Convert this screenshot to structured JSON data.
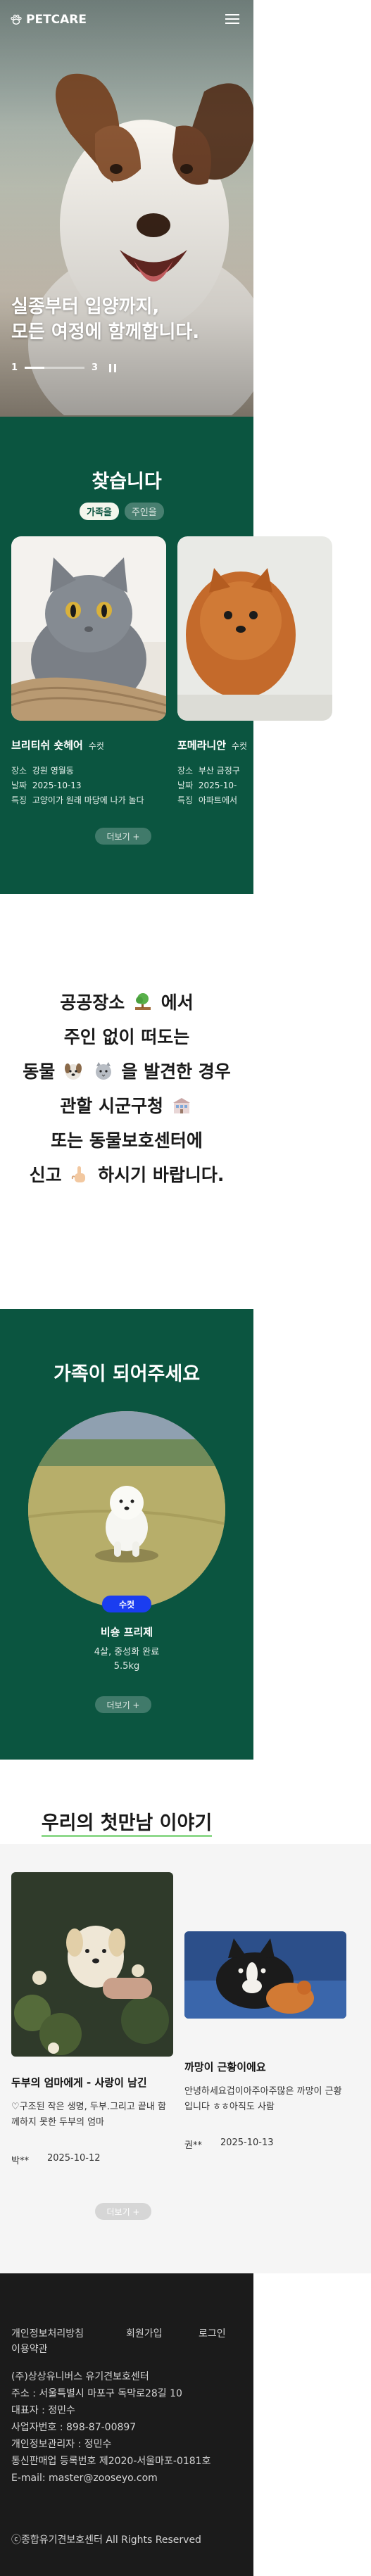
{
  "header": {
    "logo_text": "PETCARE",
    "logo_icon": "paw-icon",
    "menu_icon": "hamburger-icon"
  },
  "hero": {
    "headline_line1": "실종부터 입양까지,",
    "headline_line2": "모든 여정에 함께합니다.",
    "pager": {
      "current": "1",
      "total": "3",
      "progress": 0.33
    }
  },
  "find": {
    "title": "찾습니다",
    "tabs": [
      "가족을",
      "주인을"
    ],
    "active_tab": 0,
    "cards": [
      {
        "name": "브리티쉬 숏헤어",
        "sex": "수컷",
        "place_label": "장소",
        "place": "강원 영월동",
        "date_label": "날짜",
        "date": "2025-10-13",
        "feature_label": "특징",
        "feature": "고양이가 원래 마당에 나가 놀다"
      },
      {
        "name": "포메라니안",
        "sex": "수컷",
        "place_label": "장소",
        "place": "부산 금정구",
        "date_label": "날짜",
        "date": "2025-10-",
        "feature_label": "특징",
        "feature": "아파트에서"
      }
    ],
    "more_label": "더보기 +"
  },
  "notice": {
    "line1_a": "공공장소",
    "line1_b": "에서",
    "line2": "주인 없이 떠도는",
    "line3_a": "동물",
    "line3_b": "을 발견한 경우",
    "line4": "관할 시군구청",
    "line5": "또는 동물보호센터에",
    "line6_a": "신고",
    "line6_b": "하시기 바랍니다."
  },
  "adopt": {
    "title": "가족이 되어주세요",
    "sex_badge": "수컷",
    "name": "비숑 프리제",
    "info_line1": "4살, 중성화 완료",
    "info_line2": "5.5kg",
    "more_label": "더보기 +"
  },
  "story": {
    "title": "우리의 첫만남 이야기",
    "cards": [
      {
        "title": "두부의 엄마에게 - 사랑이 남긴",
        "body": "♡구조된 작은 생명, 두부.그리고 끝내 함께하지 못한 두부의 엄마",
        "author": "박**",
        "date": "2025-10-12"
      },
      {
        "title": "까망이 근황이에요",
        "body": "안녕하세요겁이아주아주많은 까망이 근황입니다 ㅎㅎ아직도 사람",
        "author": "권**",
        "date": "2025-10-13"
      }
    ],
    "more_label": "더보기 +"
  },
  "footer": {
    "links": [
      "개인정보처리방침",
      "회원가입",
      "로그인",
      "이용약관"
    ],
    "address_lines": [
      "(주)상상유니버스 유기견보호센터",
      "주소 : 서울특별시 마포구 독막로28길 10",
      "대표자 : 정민수",
      "사업자번호 : 898-87-00897",
      "개인정보관리자 : 정민수",
      "통신판매업 등록번호 제2020-서울마포-0181호",
      "E-mail: master@zooseyo.com"
    ],
    "copyright": "ⓒ종합유기견보호센터 All Rights Reserved"
  },
  "colors": {
    "brand_green": "#0b5540",
    "badge_blue": "#1a3df0",
    "underline_green": "#8fd98c",
    "footer_bg": "#1b1b1b"
  }
}
